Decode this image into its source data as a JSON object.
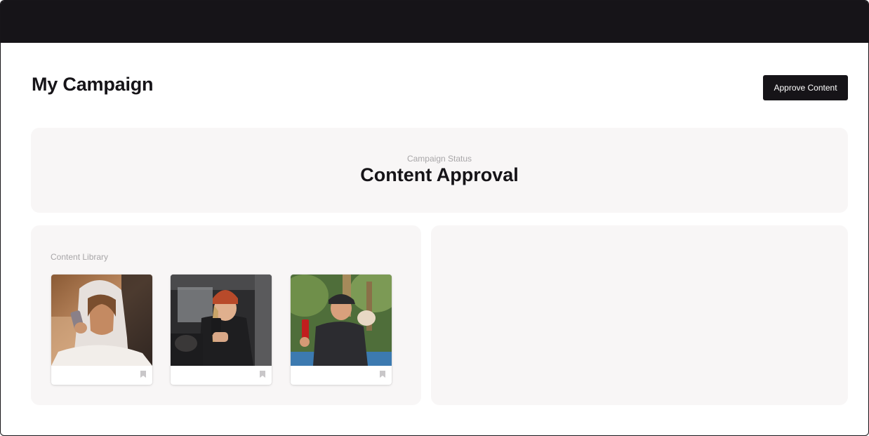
{
  "page": {
    "title": "My Campaign",
    "approve_button_label": "Approve Content"
  },
  "status": {
    "label": "Campaign Status",
    "value": "Content Approval"
  },
  "library": {
    "label": "Content Library",
    "items": [
      {
        "subject": "woman in hooded blanket holding phone",
        "icon": "bookmark-icon"
      },
      {
        "subject": "woman in red beanie taking selfie in car",
        "icon": "bookmark-icon"
      },
      {
        "subject": "man with cap and small dog taking selfie outdoors",
        "icon": "bookmark-icon"
      }
    ]
  },
  "colors": {
    "topbar": "#161418",
    "button_bg": "#161418",
    "panel_bg": "#f8f6f6",
    "muted_text": "#a8a6a8"
  }
}
